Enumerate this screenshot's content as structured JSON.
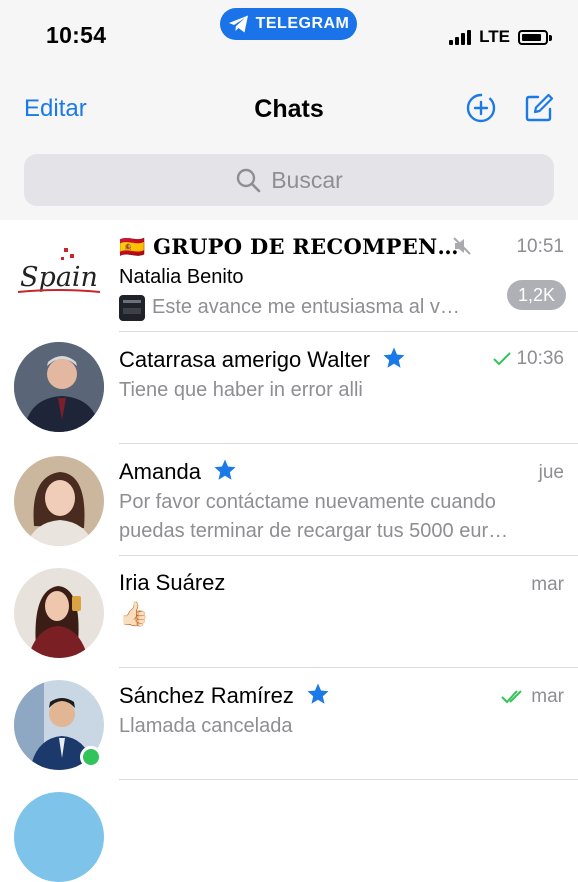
{
  "status_bar": {
    "time": "10:54",
    "pill_label": "TELEGRAM",
    "network": "LTE"
  },
  "nav": {
    "edit_label": "Editar",
    "title": "Chats"
  },
  "search": {
    "placeholder": "Buscar"
  },
  "chats": [
    {
      "flag": "🇪🇸",
      "name": "GRUPO DE RECOMPEN…",
      "sender": "Natalia Benito",
      "preview": "Este avance me entusiasma al v…",
      "time": "10:51",
      "badge": "1,2K",
      "avatar_text": "Spain",
      "muted": true
    },
    {
      "name": "Catarrasa amerigo Walter",
      "preview": "Tiene que haber in error alli",
      "time": "10:36",
      "status": "sent",
      "verified": true
    },
    {
      "name": "Amanda",
      "preview": "Por favor contáctame nuevamente cuando puedas terminar de recargar tus 5000 eur…",
      "time": "jue",
      "verified": true
    },
    {
      "name": "Iria Suárez",
      "preview": "👍🏻",
      "time": "mar"
    },
    {
      "name": "Sánchez Ramírez",
      "preview": "Llamada cancelada",
      "time": "mar",
      "status": "read",
      "verified": true,
      "online": true
    }
  ],
  "colors": {
    "accent": "#1b7ae8",
    "secondary_text": "#8e8e93",
    "check": "#32c45a",
    "online": "#32c45a"
  }
}
